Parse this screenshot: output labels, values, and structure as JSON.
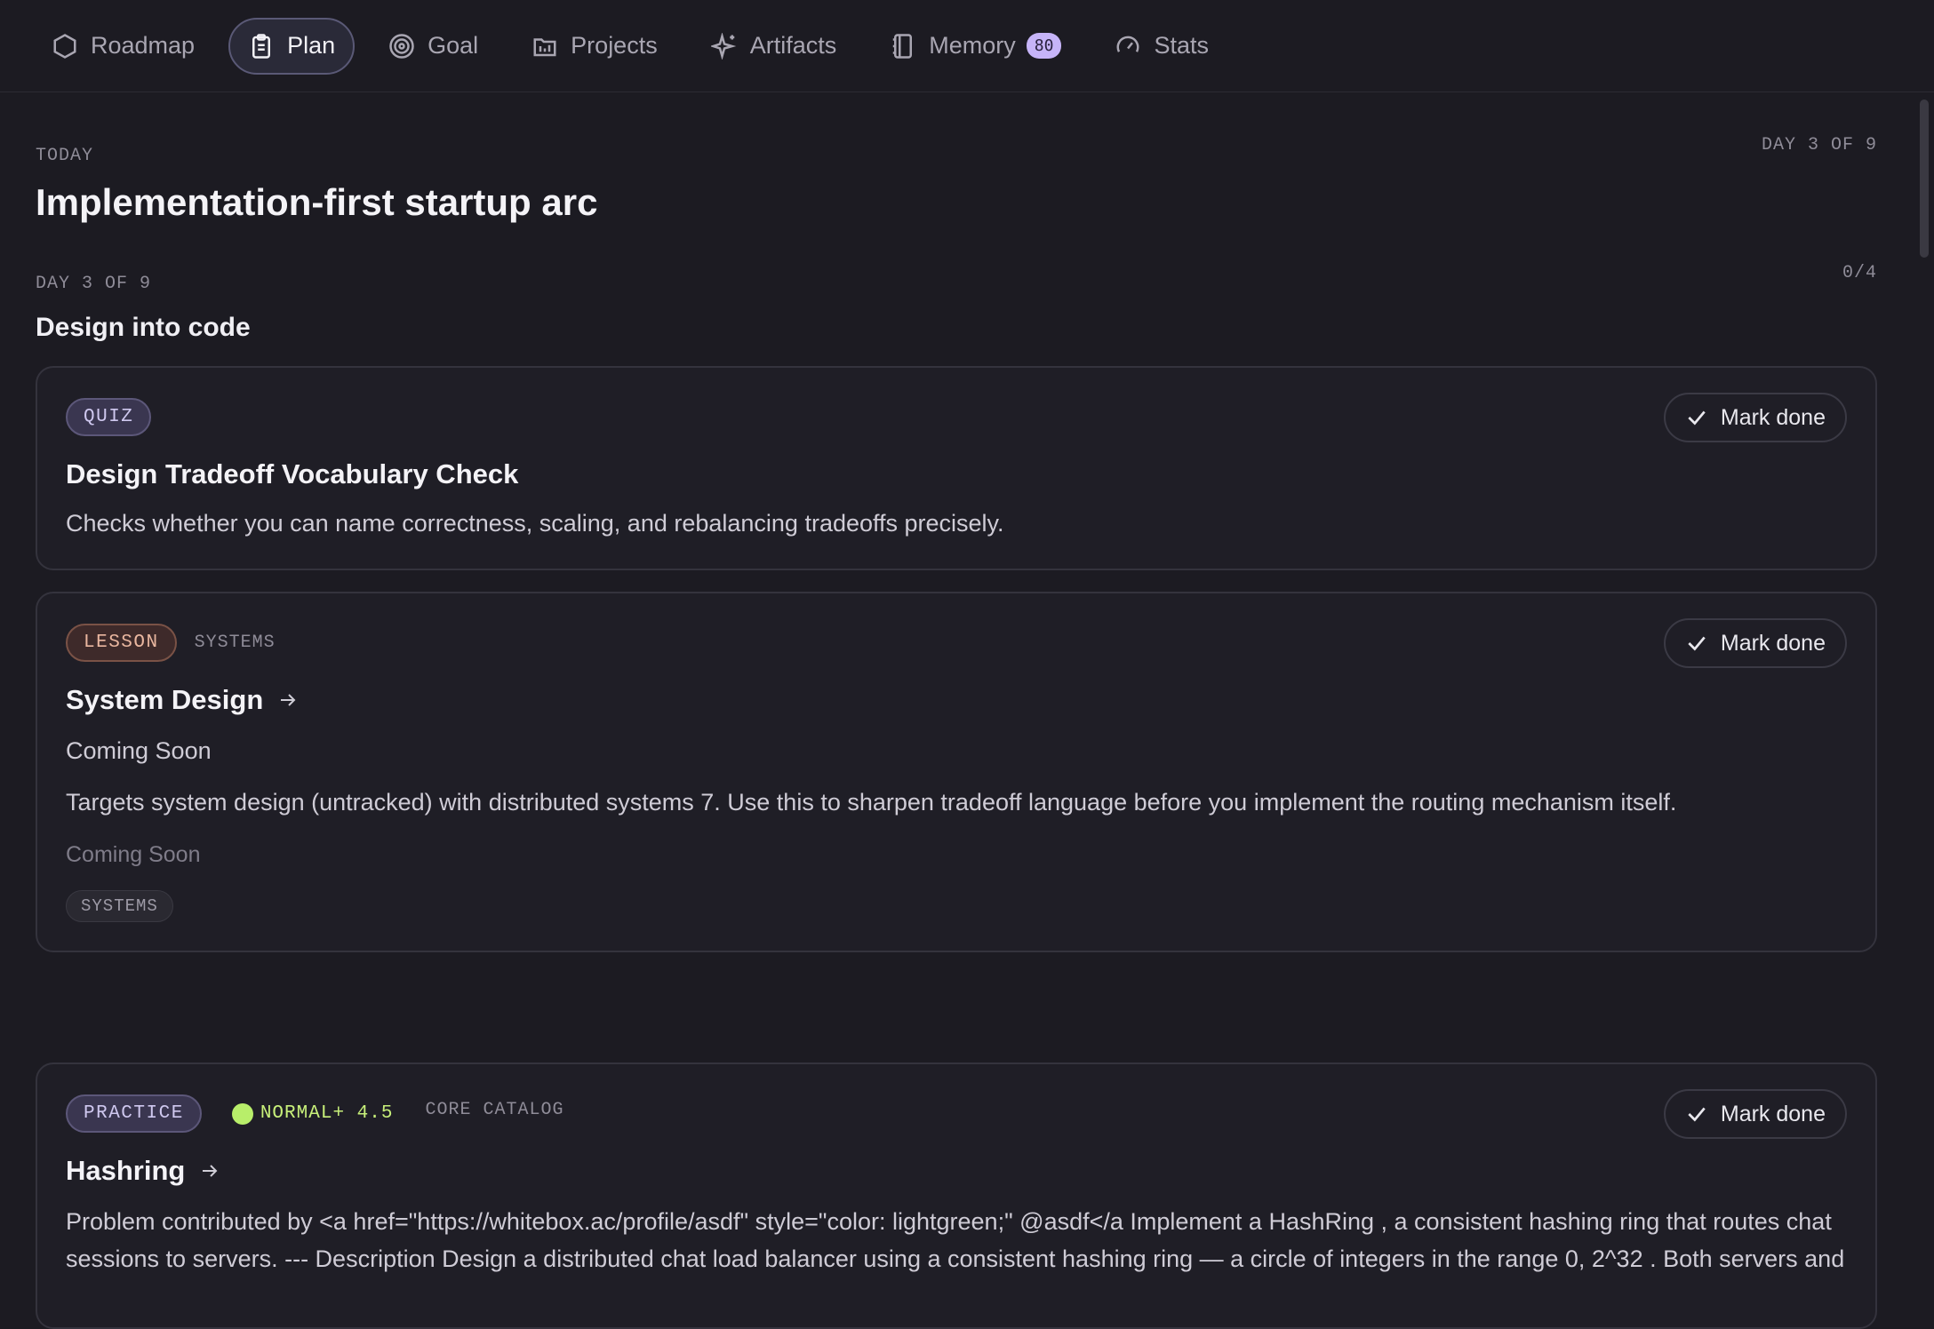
{
  "nav": {
    "items": [
      {
        "label": "Roadmap",
        "icon": "hexagon-icon"
      },
      {
        "label": "Plan",
        "icon": "clipboard-icon"
      },
      {
        "label": "Goal",
        "icon": "target-icon"
      },
      {
        "label": "Projects",
        "icon": "folder-icon"
      },
      {
        "label": "Artifacts",
        "icon": "sparkles-icon"
      },
      {
        "label": "Memory",
        "icon": "notebook-icon",
        "badge": "80"
      },
      {
        "label": "Stats",
        "icon": "gauge-icon"
      }
    ],
    "active": "Plan"
  },
  "header": {
    "today_label": "TODAY",
    "day_top": "DAY 3 OF 9",
    "title": "Implementation-first startup arc"
  },
  "section": {
    "day_label": "DAY 3 OF 9",
    "progress": "0/4",
    "title": "Design into code"
  },
  "cards": [
    {
      "tag": "QUIZ",
      "title": "Design Tradeoff Vocabulary Check",
      "description": "Checks whether you can name correctness, scaling, and rebalancing tradeoffs precisely.",
      "button": "Mark done"
    },
    {
      "tag": "LESSON",
      "subtag": "SYSTEMS",
      "title": "System Design",
      "status": "Coming Soon",
      "description": "Targets system design (untracked) with distributed systems 7. Use this to sharpen tradeoff language before you implement the routing mechanism itself.",
      "muted": "Coming Soon",
      "chip": "SYSTEMS",
      "button": "Mark done"
    },
    {
      "tag": "PRACTICE",
      "difficulty": "NORMAL+ 4.5",
      "subtag": "CORE CATALOG",
      "title": "Hashring",
      "description": "Problem contributed by <a href=\"https://whitebox.ac/profile/asdf\" style=\"color: lightgreen;\" @asdf</a Implement a HashRing , a consistent hashing ring that routes chat sessions to servers. --- Description Design a distributed chat load balancer using a consistent hashing ring — a circle of integers in the range 0, 2^32 . Both servers and",
      "button": "Mark done"
    }
  ],
  "colors": {
    "background": "#1c1b22",
    "accent": "#c6b4f8",
    "difficulty": "#b8ee6a"
  }
}
